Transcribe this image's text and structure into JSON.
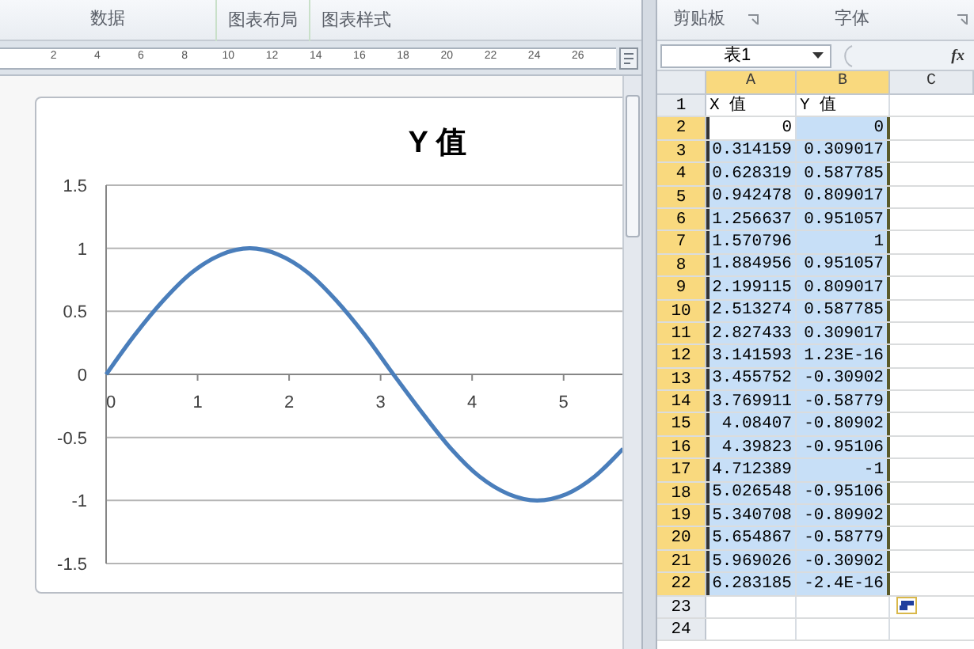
{
  "ribbon_left": {
    "groups": [
      "数据",
      "图表布局",
      "图表样式"
    ]
  },
  "ruler": {
    "labels": [
      "2",
      "4",
      "6",
      "8",
      "10",
      "12",
      "14",
      "16",
      "18",
      "20",
      "22",
      "24",
      "26"
    ]
  },
  "chart": {
    "title": "Y 值",
    "chart_data": {
      "type": "line",
      "x": [
        0,
        0.31,
        0.63,
        0.94,
        1.26,
        1.57,
        1.88,
        2.2,
        2.51,
        2.83,
        3.14,
        3.46,
        3.77,
        4.08,
        4.4,
        4.71,
        5.03,
        5.34,
        5.65
      ],
      "series": [
        {
          "color": "#4a7ebb",
          "values": [
            0,
            0.31,
            0.59,
            0.81,
            0.95,
            1,
            0.95,
            0.81,
            0.59,
            0.31,
            0,
            -0.31,
            -0.59,
            -0.81,
            -0.95,
            -1,
            -0.95,
            -0.81,
            -0.59
          ]
        }
      ],
      "xlim": [
        0,
        5.66
      ],
      "ylim": [
        -1.5,
        1.5
      ],
      "yticks": [
        -1.5,
        -1,
        -0.5,
        0,
        0.5,
        1,
        1.5
      ],
      "xticks": [
        0,
        1,
        2,
        3,
        4,
        5
      ],
      "grid": true
    }
  },
  "ribbon_right": {
    "groups": [
      "剪贴板",
      "字体"
    ]
  },
  "name_box": {
    "value": "表1"
  },
  "formula_bar": {
    "function_label": "fx"
  },
  "sheet": {
    "columns": [
      {
        "label": "A",
        "selected": true
      },
      {
        "label": "B",
        "selected": true
      },
      {
        "label": "C",
        "selected": false
      }
    ],
    "rows": [
      {
        "number": "1",
        "selected": false,
        "cells": [
          {
            "text": "X 值",
            "kind": "text"
          },
          {
            "text": "Y 值",
            "kind": "text"
          }
        ]
      },
      {
        "number": "2",
        "selected": true,
        "cells": [
          {
            "text": "0",
            "active": true
          },
          {
            "text": "0"
          }
        ]
      },
      {
        "number": "3",
        "selected": true,
        "cells": [
          {
            "text": "0.314159"
          },
          {
            "text": "0.309017"
          }
        ]
      },
      {
        "number": "4",
        "selected": true,
        "cells": [
          {
            "text": "0.628319"
          },
          {
            "text": "0.587785"
          }
        ]
      },
      {
        "number": "5",
        "selected": true,
        "cells": [
          {
            "text": "0.942478"
          },
          {
            "text": "0.809017"
          }
        ]
      },
      {
        "number": "6",
        "selected": true,
        "cells": [
          {
            "text": "1.256637"
          },
          {
            "text": "0.951057"
          }
        ]
      },
      {
        "number": "7",
        "selected": true,
        "cells": [
          {
            "text": "1.570796"
          },
          {
            "text": "1"
          }
        ]
      },
      {
        "number": "8",
        "selected": true,
        "cells": [
          {
            "text": "1.884956"
          },
          {
            "text": "0.951057"
          }
        ]
      },
      {
        "number": "9",
        "selected": true,
        "cells": [
          {
            "text": "2.199115"
          },
          {
            "text": "0.809017"
          }
        ]
      },
      {
        "number": "10",
        "selected": true,
        "cells": [
          {
            "text": "2.513274"
          },
          {
            "text": "0.587785"
          }
        ]
      },
      {
        "number": "11",
        "selected": true,
        "cells": [
          {
            "text": "2.827433"
          },
          {
            "text": "0.309017"
          }
        ]
      },
      {
        "number": "12",
        "selected": true,
        "cells": [
          {
            "text": "3.141593"
          },
          {
            "text": "1.23E-16"
          }
        ]
      },
      {
        "number": "13",
        "selected": true,
        "cells": [
          {
            "text": "3.455752"
          },
          {
            "text": "-0.30902"
          }
        ]
      },
      {
        "number": "14",
        "selected": true,
        "cells": [
          {
            "text": "3.769911"
          },
          {
            "text": "-0.58779"
          }
        ]
      },
      {
        "number": "15",
        "selected": true,
        "cells": [
          {
            "text": "4.08407"
          },
          {
            "text": "-0.80902"
          }
        ]
      },
      {
        "number": "16",
        "selected": true,
        "cells": [
          {
            "text": "4.39823"
          },
          {
            "text": "-0.95106"
          }
        ]
      },
      {
        "number": "17",
        "selected": true,
        "cells": [
          {
            "text": "4.712389"
          },
          {
            "text": "-1"
          }
        ]
      },
      {
        "number": "18",
        "selected": true,
        "cells": [
          {
            "text": "5.026548"
          },
          {
            "text": "-0.95106"
          }
        ]
      },
      {
        "number": "19",
        "selected": true,
        "cells": [
          {
            "text": "5.340708"
          },
          {
            "text": "-0.80902"
          }
        ]
      },
      {
        "number": "20",
        "selected": true,
        "cells": [
          {
            "text": "5.654867"
          },
          {
            "text": "-0.58779"
          }
        ]
      },
      {
        "number": "21",
        "selected": true,
        "cells": [
          {
            "text": "5.969026"
          },
          {
            "text": "-0.30902"
          }
        ]
      },
      {
        "number": "22",
        "selected": true,
        "cells": [
          {
            "text": "6.283185"
          },
          {
            "text": "-2.4E-16"
          }
        ]
      },
      {
        "number": "23",
        "selected": false
      },
      {
        "number": "24",
        "selected": false
      }
    ]
  }
}
